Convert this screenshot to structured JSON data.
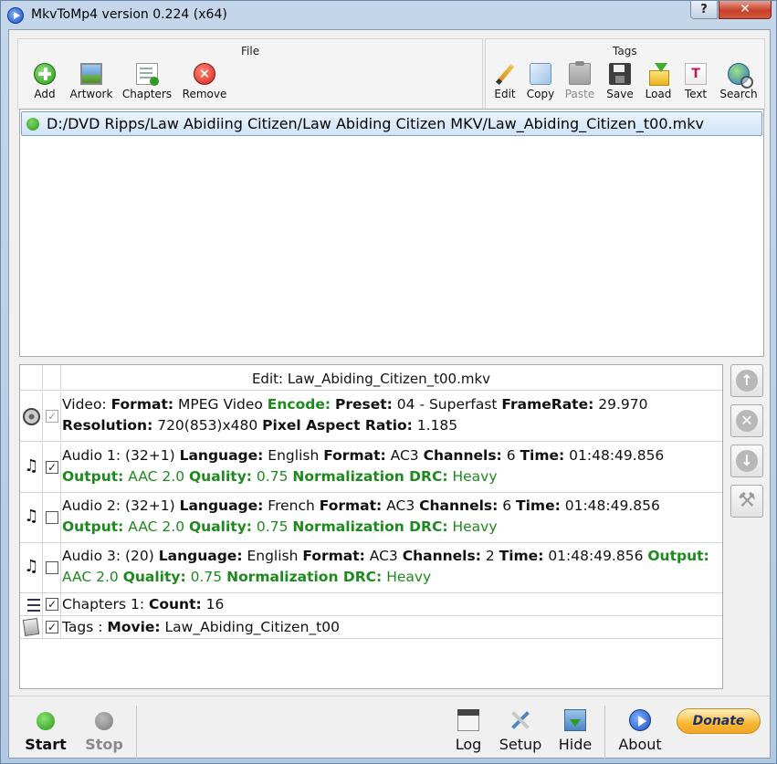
{
  "window": {
    "title": "MkvToMp4 version 0.224 (x64)",
    "help_label": "?",
    "close_label": "✕"
  },
  "toolbar": {
    "file_group_title": "File",
    "tags_group_title": "Tags",
    "file_buttons": [
      {
        "label": "Add",
        "icon": "add-icon"
      },
      {
        "label": "Artwork",
        "icon": "artwork-icon"
      },
      {
        "label": "Chapters",
        "icon": "chapters-icon"
      },
      {
        "label": "Remove",
        "icon": "remove-icon",
        "glyph": "✕"
      }
    ],
    "tag_buttons": [
      {
        "label": "Edit",
        "icon": "pencil-icon"
      },
      {
        "label": "Copy",
        "icon": "copy-icon"
      },
      {
        "label": "Paste",
        "icon": "paste-icon",
        "disabled": true
      },
      {
        "label": "Save",
        "icon": "save-icon"
      },
      {
        "label": "Load",
        "icon": "load-icon"
      },
      {
        "label": "Text",
        "icon": "text-icon",
        "glyph": "T"
      },
      {
        "label": "Search",
        "icon": "search-icon"
      }
    ]
  },
  "file_list": {
    "items": [
      {
        "path": "D:/DVD Ripps/Law Abidiing Citizen/Law Abiding Citizen MKV/Law_Abiding_Citizen_t00.mkv",
        "status_color": "#2b9a18"
      }
    ]
  },
  "edit_panel": {
    "title": "Edit: Law_Abiding_Citizen_t00.mkv",
    "tracks": [
      {
        "kind": "video",
        "checked": true,
        "prefix": "Video: ",
        "format_key": "Format:",
        "format_val": " MPEG Video ",
        "encode_key": "Encode:",
        "encode_rest": " ",
        "preset_key": "Preset:",
        "preset_val": " 04 - Superfast ",
        "framerate_key": "FrameRate:",
        "framerate_val": " 29.970 ",
        "resolution_key": "Resolution:",
        "resolution_val": " 720(853)x480 ",
        "par_key": "Pixel Aspect Ratio:",
        "par_val": " 1.185"
      },
      {
        "kind": "audio",
        "checked": true,
        "prefix": "Audio 1: (32+1) ",
        "language_key": "Language:",
        "language_val": " English ",
        "format_key": "Format:",
        "format_val": " AC3 ",
        "channels_key": "Channels:",
        "channels_val": " 6 ",
        "time_key": "Time:",
        "time_val": " 01:48:49.856 ",
        "output_key": "Output:",
        "output_val": " AAC 2.0 ",
        "quality_key": "Quality:",
        "quality_val": " 0.75 ",
        "norm_key": "Normalization DRC:",
        "norm_val": " Heavy"
      },
      {
        "kind": "audio",
        "checked": false,
        "prefix": "Audio 2: (32+1) ",
        "language_key": "Language:",
        "language_val": " French ",
        "format_key": "Format:",
        "format_val": " AC3 ",
        "channels_key": "Channels:",
        "channels_val": " 6 ",
        "time_key": "Time:",
        "time_val": " 01:48:49.856 ",
        "output_key": "Output:",
        "output_val": " AAC 2.0 ",
        "quality_key": "Quality:",
        "quality_val": " 0.75 ",
        "norm_key": "Normalization DRC:",
        "norm_val": " Heavy"
      },
      {
        "kind": "audio",
        "checked": false,
        "prefix": "Audio 3: (20) ",
        "language_key": "Language:",
        "language_val": " English ",
        "format_key": "Format:",
        "format_val": " AC3 ",
        "channels_key": "Channels:",
        "channels_val": " 2 ",
        "time_key": "Time:",
        "time_val": " 01:48:49.856 ",
        "output_key": "Output:",
        "output_val": " AAC 2.0 ",
        "quality_key": "Quality:",
        "quality_val": " 0.75 ",
        "norm_key": "Normalization DRC:",
        "norm_val": " Heavy"
      },
      {
        "kind": "chapters",
        "checked": true,
        "prefix": "Chapters 1: ",
        "count_key": "Count:",
        "count_val": " 16"
      },
      {
        "kind": "tags",
        "checked": true,
        "prefix": "Tags : ",
        "movie_key": "Movie:",
        "movie_val": " Law_Abiding_Citizen_t00"
      }
    ],
    "check_glyph": "✓",
    "side_buttons": [
      {
        "name": "move-up-button",
        "glyph": "↑"
      },
      {
        "name": "remove-track-button",
        "glyph": "✕"
      },
      {
        "name": "move-down-button",
        "glyph": "↓"
      },
      {
        "name": "tools-button",
        "glyph": "⚒"
      }
    ]
  },
  "bottom_bar": {
    "start_label": "Start",
    "stop_label": "Stop",
    "log_label": "Log",
    "setup_label": "Setup",
    "hide_label": "Hide",
    "about_label": "About",
    "donate_label": "Donate"
  },
  "colors": {
    "accent_green": "#1d8a1d",
    "selection_border": "#7da2ce",
    "donate_gold": "#f7b733"
  }
}
